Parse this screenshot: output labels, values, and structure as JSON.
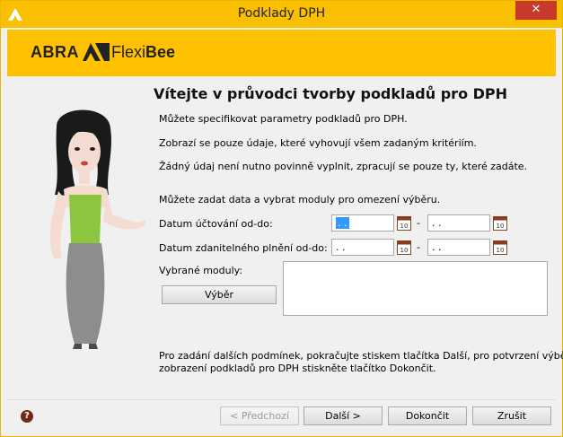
{
  "window": {
    "title": "Podklady DPH",
    "close_glyph": "✕"
  },
  "banner": {
    "logo_abra": "ABRA",
    "logo_flexi": "Flexi",
    "logo_bee": "Bee"
  },
  "intro": {
    "heading": "Vítejte v průvodci tvorby podkladů pro DPH",
    "line1": "Můžete specifikovat parametry podkladů pro DPH.",
    "line2": "Zobrazí se pouze údaje, které vyhovují všem zadaným kritériím.",
    "line3": "Žádný údaj není nutno povinně vyplnit, zpracují se pouze ty, které zadáte.",
    "line4": "Můžete zadat data a vybrat moduly pro omezení výběru."
  },
  "form": {
    "accounting_date_label": "Datum účtování od-do:",
    "taxable_date_label": "Datum zdanitelného plnění od-do:",
    "modules_label": "Vybrané moduly:",
    "select_button": "Výběr",
    "date_placeholder": " .  .",
    "range_dash": "-",
    "calendar_day": "10"
  },
  "footer_note": {
    "line1": "Pro zadání dalších podmínek, pokračujte stiskem tlačítka Další, pro potvrzení výběru a",
    "line2": "zobrazení podkladů pro DPH stiskněte tlačítko Dokončit."
  },
  "buttons": {
    "prev": "< Předchozí",
    "next": "Další >",
    "finish": "Dokončit",
    "cancel": "Zrušit",
    "help": "?"
  },
  "icons": {
    "app": "abra-logo-icon",
    "calendar": "calendar-icon",
    "help": "help-icon"
  },
  "colors": {
    "accent": "#ffc200",
    "titlebar": "#f9bf00",
    "close": "#c7392b"
  }
}
